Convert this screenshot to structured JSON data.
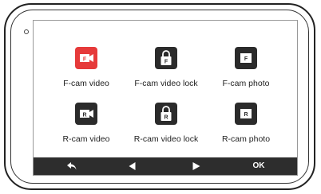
{
  "menu": {
    "items": [
      {
        "label": "F-cam video",
        "badge": "F",
        "icon": "camera-video-icon",
        "selected": true
      },
      {
        "label": "F-cam video lock",
        "badge": "F",
        "icon": "lock-icon",
        "selected": false
      },
      {
        "label": "F-cam photo",
        "badge": "F",
        "icon": "photo-icon",
        "selected": false
      },
      {
        "label": "R-cam video",
        "badge": "R",
        "icon": "camera-video-icon",
        "selected": false
      },
      {
        "label": "R-cam video lock",
        "badge": "R",
        "icon": "lock-icon",
        "selected": false
      },
      {
        "label": "R-cam photo",
        "badge": "R",
        "icon": "photo-icon",
        "selected": false
      }
    ]
  },
  "nav": {
    "back_icon": "back-arrow-icon",
    "left_icon": "triangle-left-icon",
    "right_icon": "triangle-right-icon",
    "ok_label": "OK"
  },
  "colors": {
    "selected": "#e63a3a",
    "icon_dark": "#2b2b2b",
    "bar": "#2d2d2d"
  }
}
